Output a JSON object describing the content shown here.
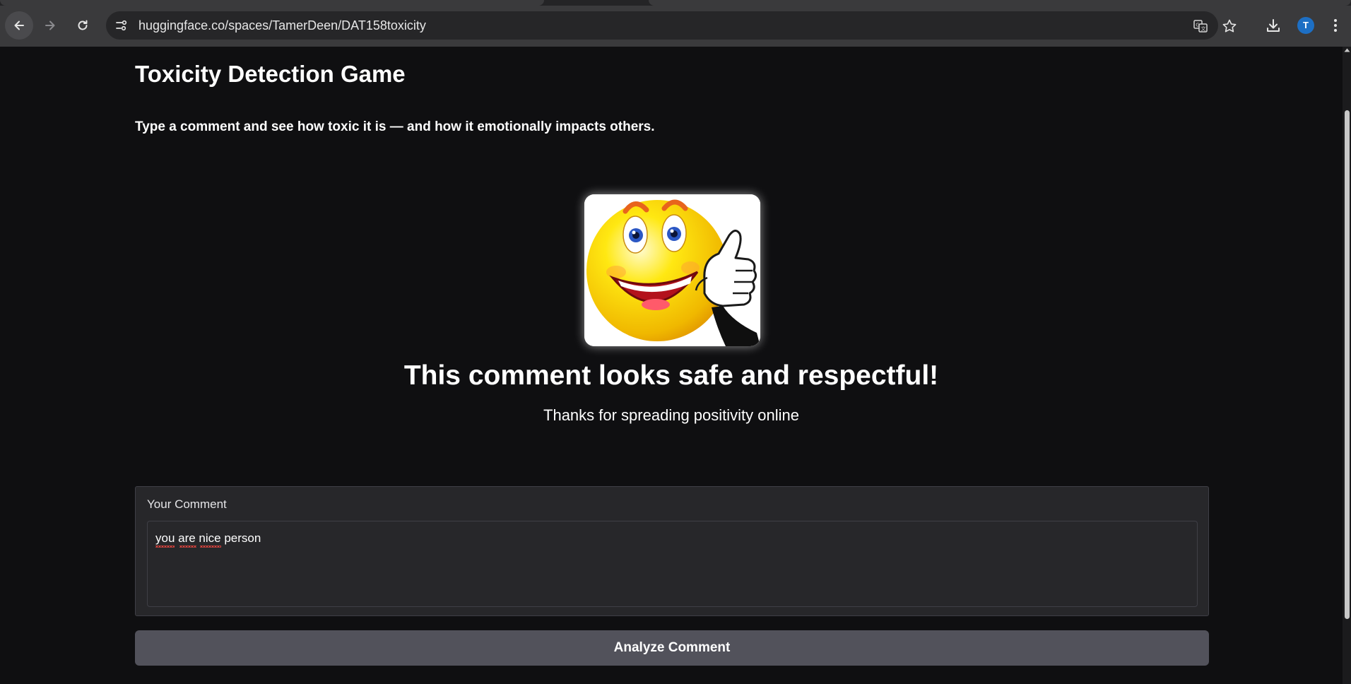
{
  "browser": {
    "url": "huggingface.co/spaces/TamerDeen/DAT158toxicity",
    "profile_initial": "T",
    "accent": "#1d6fc4"
  },
  "page": {
    "title": "Toxicity Detection Game",
    "subtitle": "Type a comment and see how toxic it is — and how it emotionally impacts others.",
    "result_title": "This comment looks safe and respectful!",
    "result_subtitle": "Thanks for spreading positivity online",
    "result_image": "smiley-thumbs-up",
    "comment": {
      "label": "Your Comment",
      "value": "you are nice person"
    },
    "analyze_button": "Analyze Comment"
  },
  "colors": {
    "background": "#0f0f11",
    "panel": "#27272a",
    "button": "#52525b"
  }
}
